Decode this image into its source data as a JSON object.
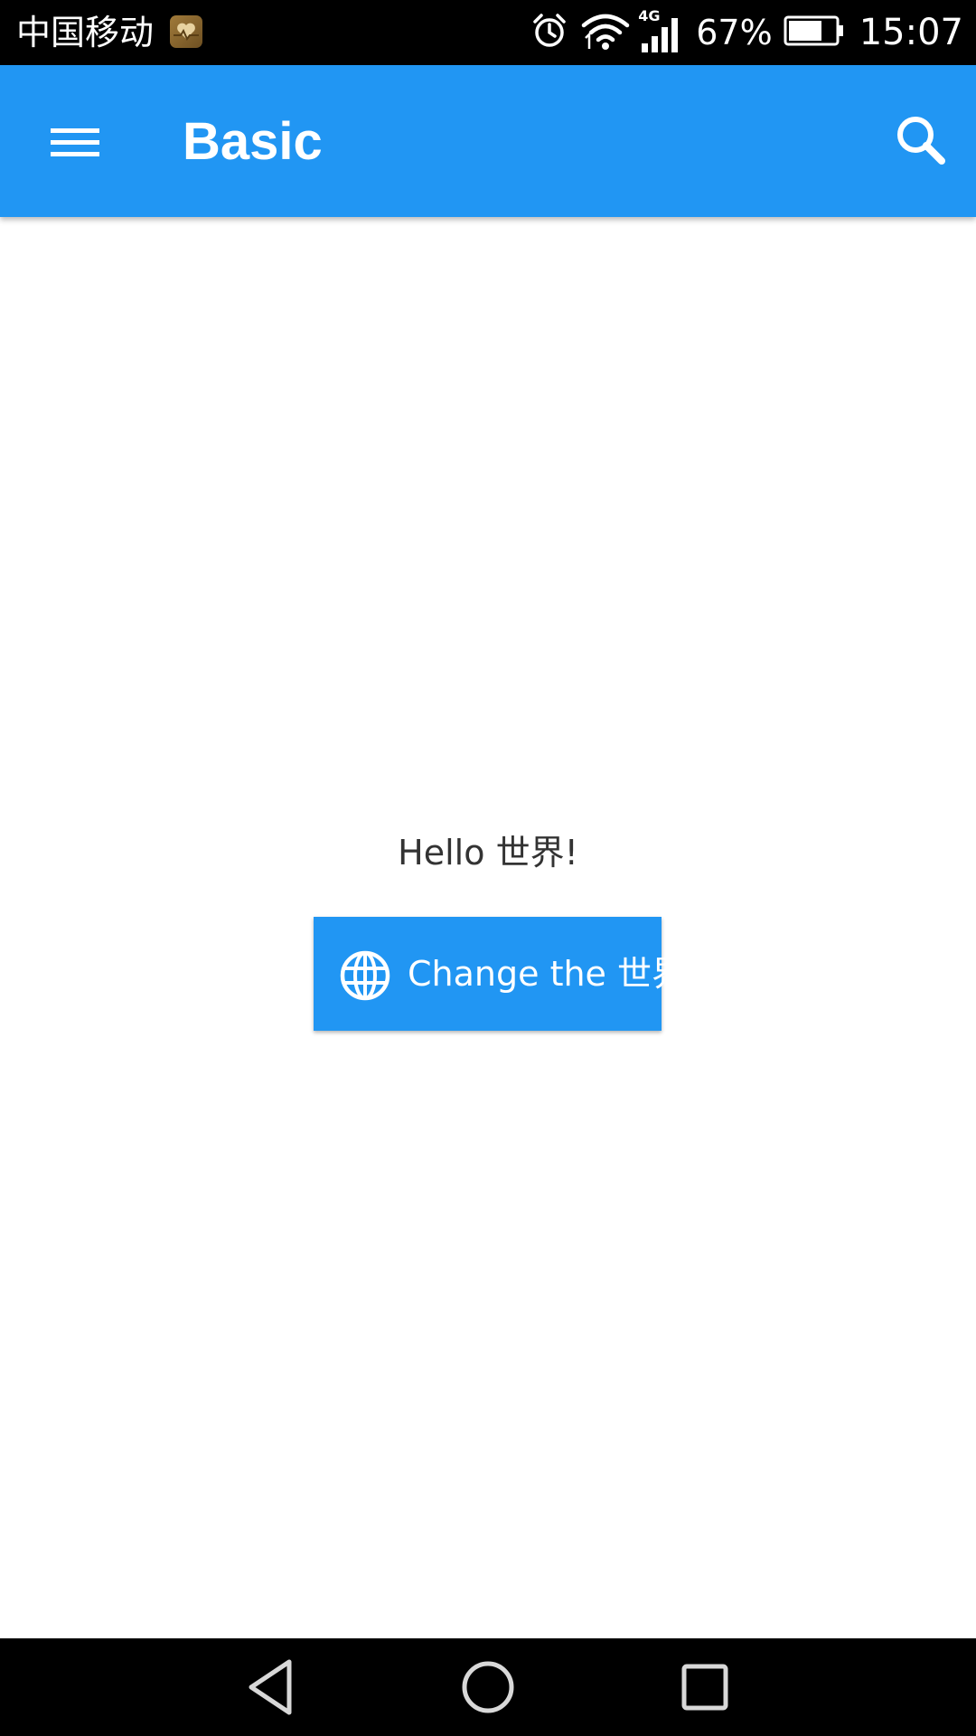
{
  "status_bar": {
    "carrier": "中国移动",
    "network_type": "4G",
    "battery_percent": "67%",
    "time": "15:07",
    "icons": [
      "health-app-icon",
      "alarm-icon",
      "wifi-icon",
      "signal-icon",
      "battery-icon"
    ]
  },
  "app_bar": {
    "title": "Basic",
    "menu_icon": "hamburger-menu-icon",
    "search_icon": "search-icon",
    "color": "#2196F3"
  },
  "content": {
    "greeting": "Hello 世界!",
    "change_button": {
      "label": "Change the 世界!",
      "icon": "globe-icon"
    }
  },
  "nav_bar": {
    "buttons": [
      "back-icon",
      "home-icon",
      "recents-icon"
    ]
  }
}
